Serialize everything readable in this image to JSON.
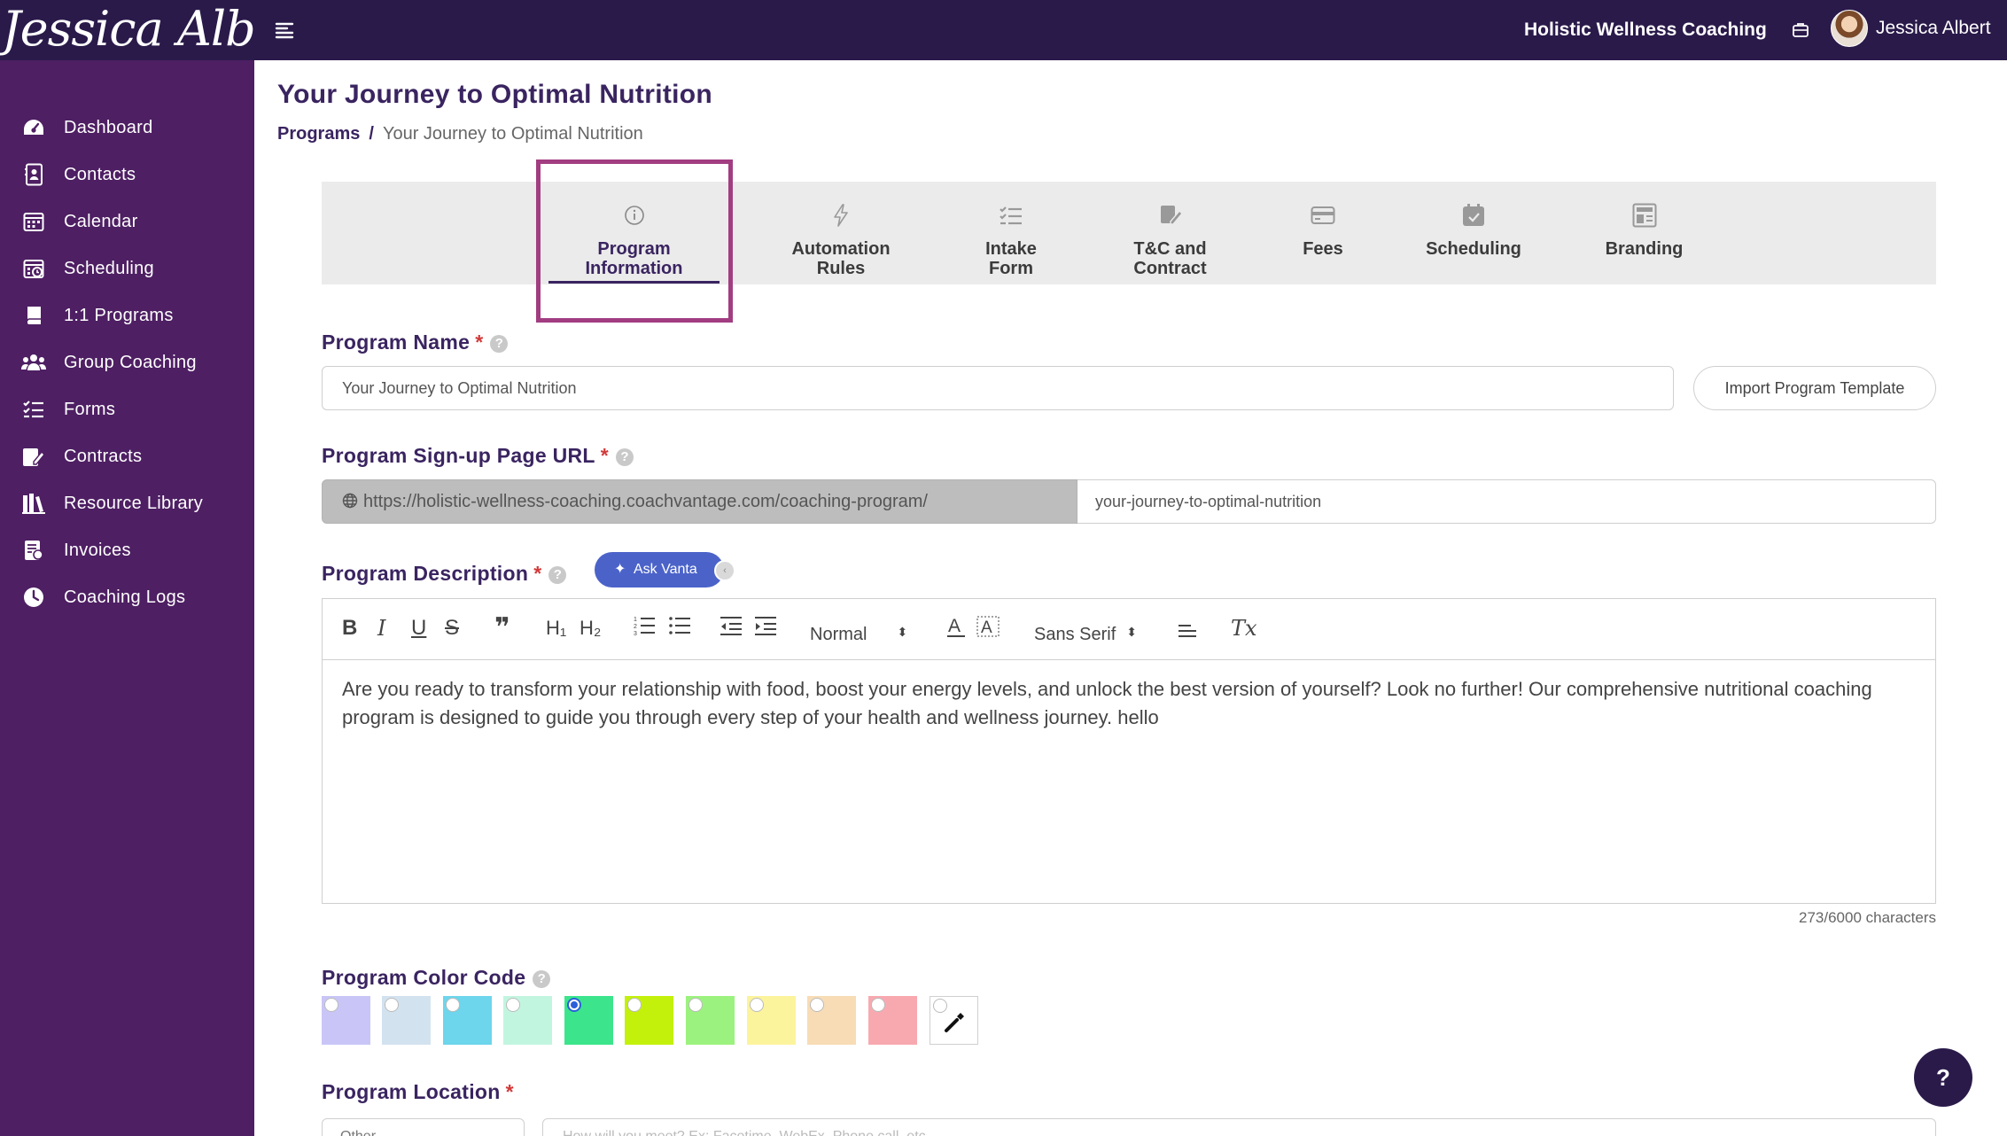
{
  "header": {
    "logo_text": "Jessica Albert",
    "company": "Holistic Wellness Coaching",
    "user_name": "Jessica Albert"
  },
  "sidebar": {
    "items": [
      {
        "label": "Dashboard",
        "icon": "dashboard-icon"
      },
      {
        "label": "Contacts",
        "icon": "contacts-icon"
      },
      {
        "label": "Calendar",
        "icon": "calendar-icon"
      },
      {
        "label": "Scheduling",
        "icon": "scheduling-icon"
      },
      {
        "label": "1:1 Programs",
        "icon": "book-icon"
      },
      {
        "label": "Group Coaching",
        "icon": "group-icon"
      },
      {
        "label": "Forms",
        "icon": "forms-icon"
      },
      {
        "label": "Contracts",
        "icon": "contract-icon"
      },
      {
        "label": "Resource Library",
        "icon": "library-icon"
      },
      {
        "label": "Invoices",
        "icon": "invoice-icon"
      },
      {
        "label": "Coaching Logs",
        "icon": "clock-icon"
      }
    ]
  },
  "page": {
    "title": "Your Journey to Optimal Nutrition",
    "breadcrumb": {
      "root": "Programs",
      "separator": "/",
      "current": "Your Journey to Optimal Nutrition"
    }
  },
  "tabs": [
    {
      "label": "Program\nInformation",
      "icon": "info-icon",
      "active": true
    },
    {
      "label": "Automation\nRules",
      "icon": "lightning-icon",
      "active": false
    },
    {
      "label": "Intake\nForm",
      "icon": "checklist-icon",
      "active": false
    },
    {
      "label": "T&C and\nContract",
      "icon": "signature-icon",
      "active": false
    },
    {
      "label": "Fees",
      "icon": "card-icon",
      "active": false
    },
    {
      "label": "Scheduling",
      "icon": "calendar-check-icon",
      "active": false
    },
    {
      "label": "Branding",
      "icon": "branding-icon",
      "active": false
    }
  ],
  "form": {
    "program_name": {
      "label": "Program Name",
      "required_mark": "*",
      "value": "Your Journey to Optimal Nutrition",
      "import_button": "Import Program Template"
    },
    "signup_url": {
      "label": "Program Sign-up Page URL",
      "required_mark": "*",
      "prefix": "https://holistic-wellness-coaching.coachvantage.com/coaching-program/",
      "slug": "your-journey-to-optimal-nutrition"
    },
    "description": {
      "label": "Program Description",
      "required_mark": "*",
      "ask_button": "Ask Vanta",
      "toolbar": {
        "bold": "B",
        "italic": "I",
        "underline": "U",
        "strike": "S",
        "quote": "❞",
        "h1": "H₁",
        "h2": "H₂",
        "size": "Normal",
        "font": "Sans Serif",
        "clear": "Tx"
      },
      "text": "Are you ready to transform your relationship with food, boost your energy levels, and unlock the best version of yourself? Look no further! Our comprehensive nutritional coaching program is designed to guide you through every step of your health and wellness journey. hello",
      "char_count": "273/6000 characters"
    },
    "color_code": {
      "label": "Program Color Code",
      "colors": [
        "#c9c6f7",
        "#d3e2ef",
        "#6dd5ec",
        "#c2f5e0",
        "#3ce58c",
        "#c3f10c",
        "#9cf27e",
        "#fcf39d",
        "#f7dcb6",
        "#f8a9b0"
      ],
      "selected_index": 4
    },
    "location": {
      "label": "Program Location",
      "required_mark": "*",
      "select_value": "Other",
      "placeholder": "How will you meet? Ex: Facetime, WebEx, Phone call, etc."
    }
  },
  "help_button": "?"
}
